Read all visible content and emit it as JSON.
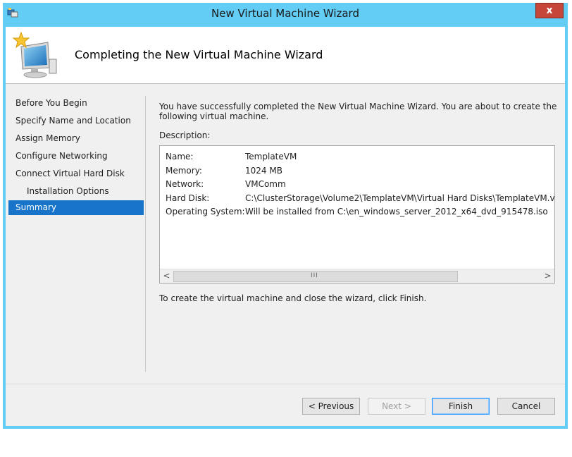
{
  "window": {
    "title": "New Virtual Machine Wizard",
    "close_label": "x",
    "accent": "#63cdf6"
  },
  "header": {
    "heading": "Completing the New Virtual Machine Wizard",
    "icon": "computer-wizard-icon"
  },
  "nav": {
    "items": [
      {
        "label": "Before You Begin"
      },
      {
        "label": "Specify Name and Location"
      },
      {
        "label": "Assign Memory"
      },
      {
        "label": "Configure Networking"
      },
      {
        "label": "Connect Virtual Hard Disk"
      },
      {
        "label": "Installation Options"
      },
      {
        "label": "Summary"
      }
    ],
    "active_color": "#1874c9"
  },
  "main": {
    "intro": "You have successfully completed the New Virtual Machine Wizard. You are about to create the following virtual machine.",
    "description_label": "Description:",
    "rows": [
      {
        "key": "Name:",
        "value": "TemplateVM"
      },
      {
        "key": "Memory:",
        "value": "1024 MB"
      },
      {
        "key": "Network:",
        "value": "VMComm"
      },
      {
        "key": "Hard Disk:",
        "value": "C:\\ClusterStorage\\Volume2\\TemplateVM\\Virtual Hard Disks\\TemplateVM.vhdx (VH"
      },
      {
        "key": "Operating System:",
        "value": "Will be installed from C:\\en_windows_server_2012_x64_dvd_915478.iso"
      }
    ],
    "scroll_grip": "III",
    "finish_note": "To create the virtual machine and close the wizard, click Finish."
  },
  "buttons": {
    "previous": "< Previous",
    "next": "Next >",
    "finish": "Finish",
    "cancel": "Cancel"
  }
}
